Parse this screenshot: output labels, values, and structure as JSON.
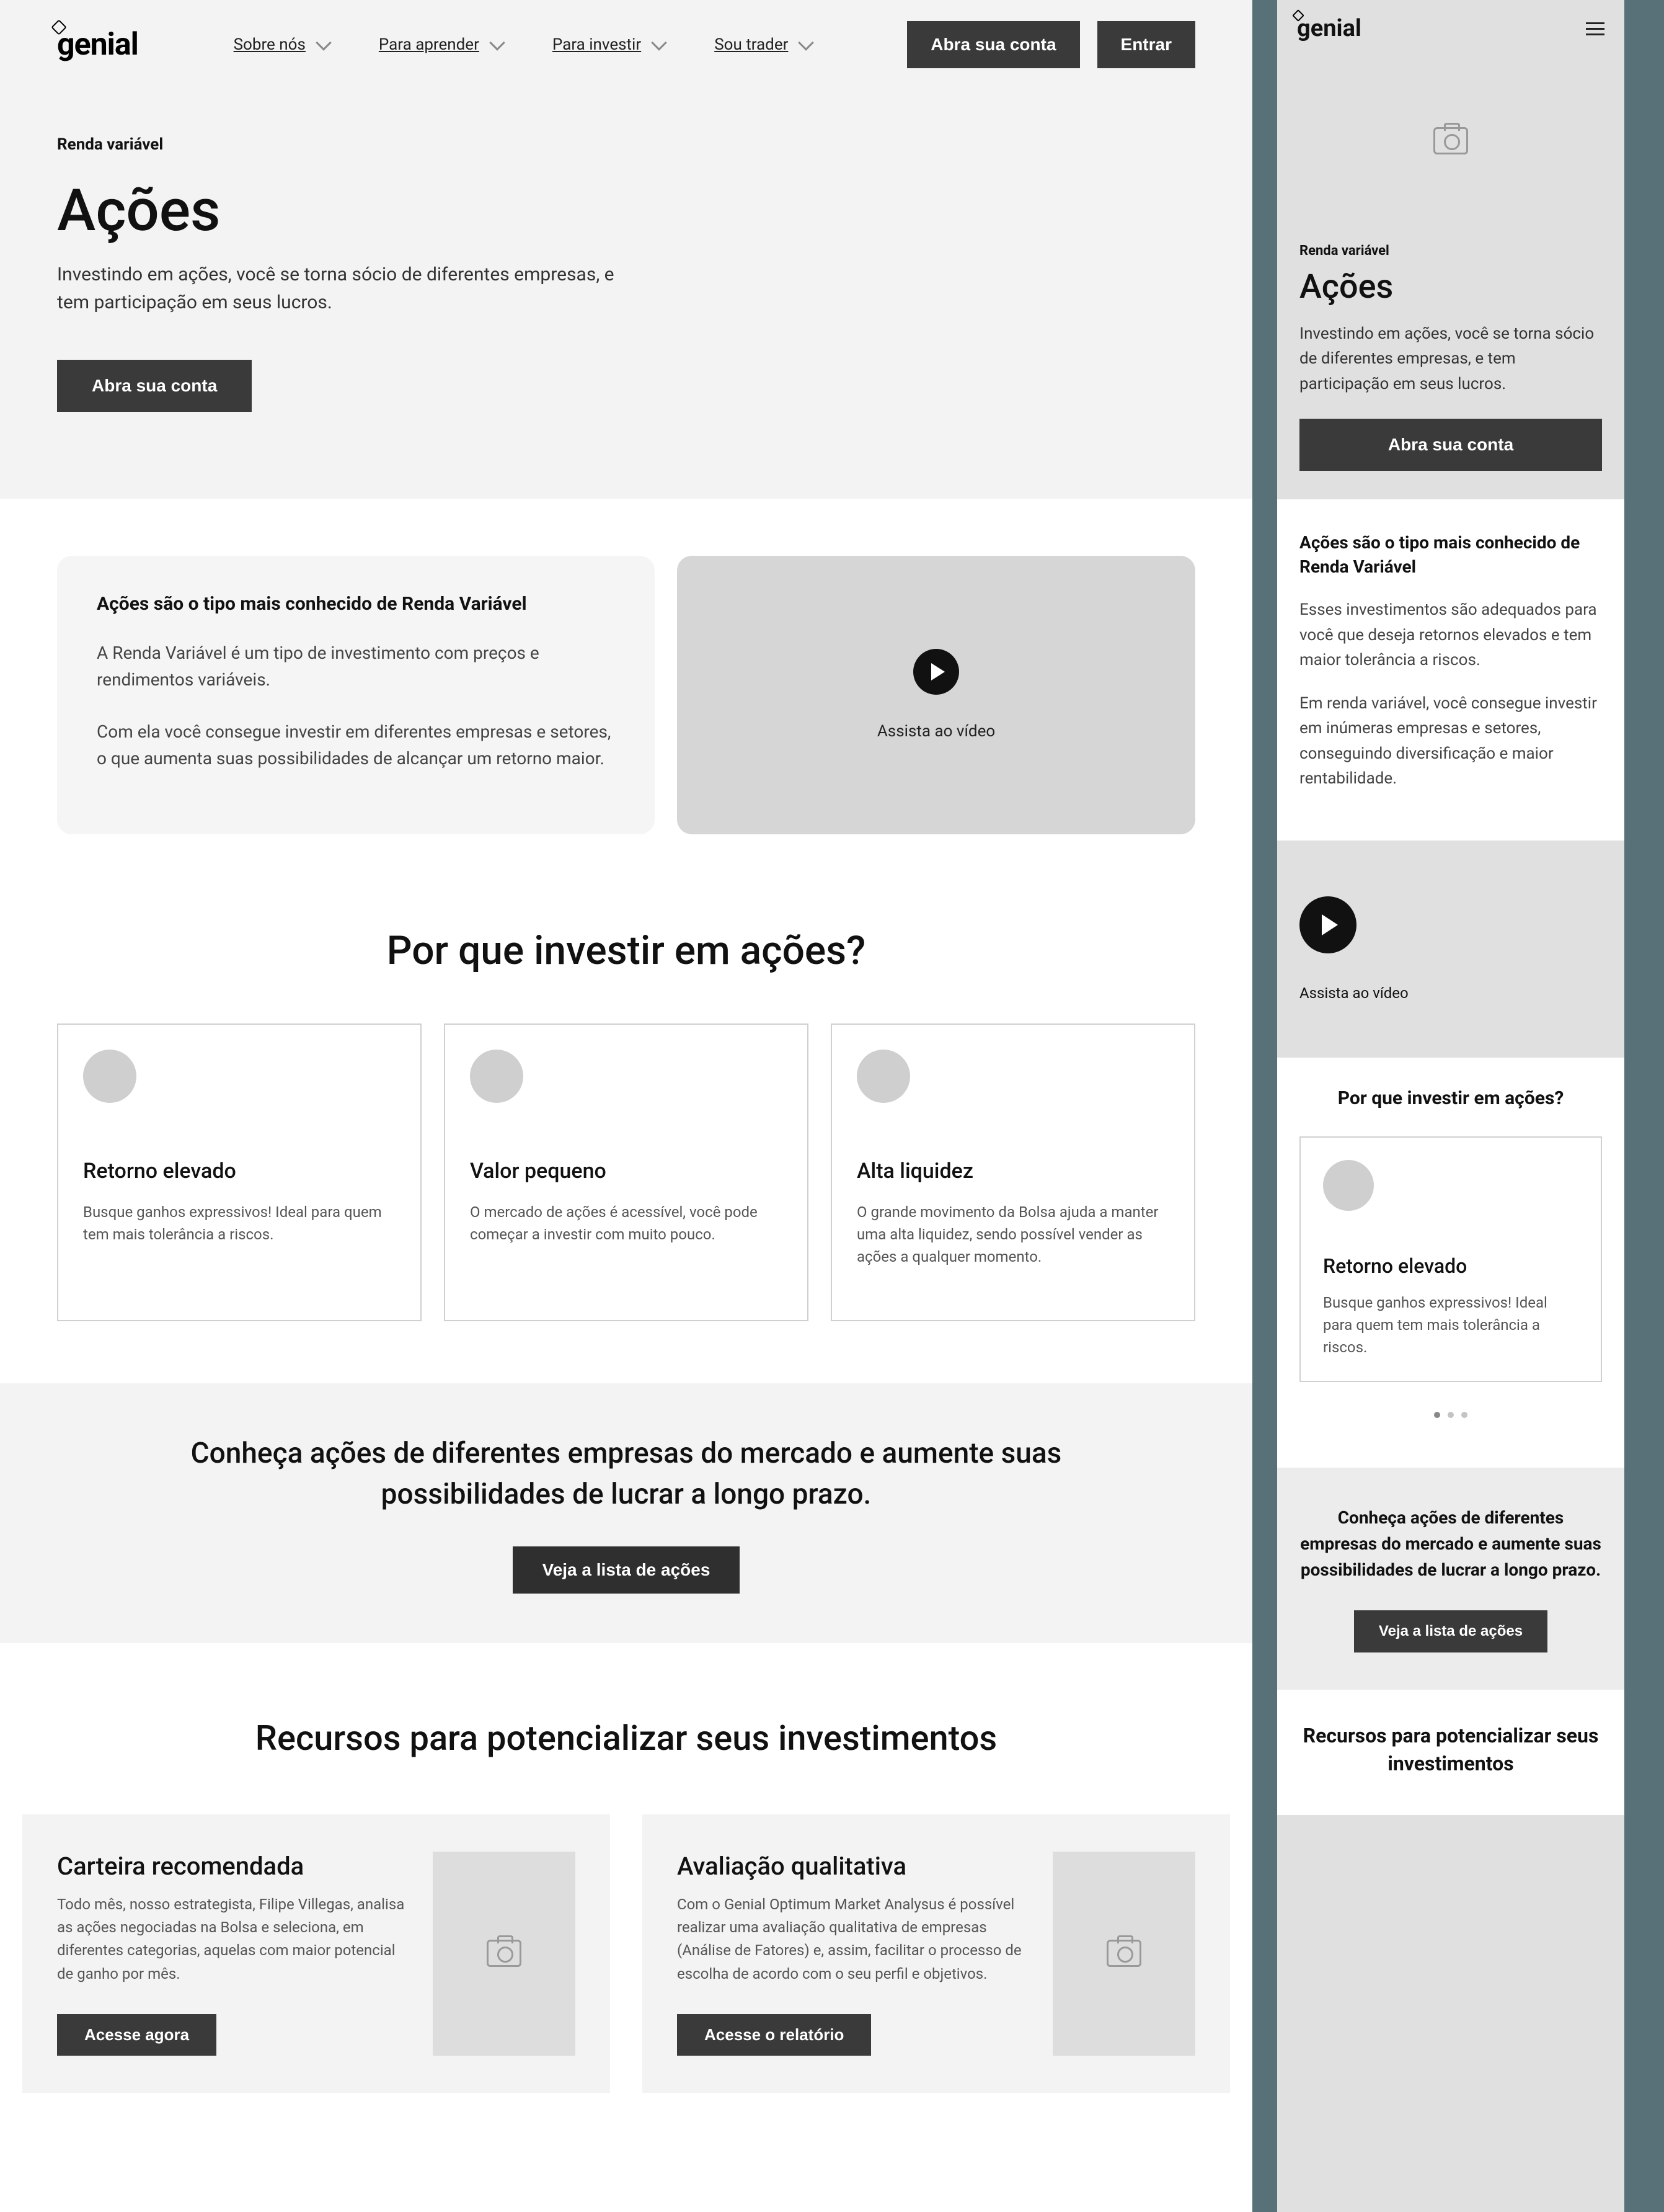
{
  "nav": {
    "logo": "genial",
    "items": [
      "Sobre nós",
      "Para aprender",
      "Para investir",
      "Sou trader"
    ],
    "cta_primary": "Abra sua conta",
    "cta_secondary": "Entrar"
  },
  "hero": {
    "eyebrow": "Renda variável",
    "title": "Ações",
    "subtitle": "Investindo em ações, você se torna sócio de diferentes empresas, e tem participação em seus lucros.",
    "cta": "Abra sua conta"
  },
  "info": {
    "heading": "Ações são o tipo mais conhecido de Renda Variável",
    "p1": "A Renda Variável é um tipo de investimento com preços e rendimentos variáveis.",
    "p2": "Com  ela você consegue investir em diferentes empresas e setores, o que aumenta suas possibilidades de alcançar um retorno maior.",
    "video_caption": "Assista ao vídeo"
  },
  "why": {
    "title": "Por que investir em ações?",
    "cards": [
      {
        "title": "Retorno elevado",
        "text": "Busque ganhos expressivos! Ideal para quem tem mais tolerância a riscos."
      },
      {
        "title": "Valor pequeno",
        "text": "O mercado de ações é acessível, você pode começar a investir com muito pouco."
      },
      {
        "title": "Alta liquidez",
        "text": "O grande movimento da Bolsa ajuda a manter uma alta liquidez, sendo possível vender as ações a qualquer momento."
      }
    ]
  },
  "band": {
    "heading": "Conheça ações de diferentes empresas do mercado e aumente suas possibilidades de lucrar a longo prazo.",
    "cta": "Veja a lista de ações"
  },
  "resources": {
    "title": "Recursos para potencializar seus investimentos",
    "cards": [
      {
        "title": "Carteira recomendada",
        "text": "Todo mês, nosso estrategista, Filipe Villegas, analisa as ações negociadas na Bolsa e seleciona, em diferentes categorias, aquelas com maior potencial de ganho por mês.",
        "cta": "Acesse agora"
      },
      {
        "title": "Avaliação qualitativa",
        "text": "Com o Genial Optimum Market Analysus é possível realizar uma avaliação qualitativa de empresas (Análise de Fatores) e, assim, facilitar o processo de escolha de acordo com o seu perfil e objetivos.",
        "cta": "Acesse o relatório"
      }
    ]
  },
  "mobile_info": {
    "heading": "Ações são o tipo mais conhecido de Renda Variável",
    "p1": "Esses investimentos são adequados para você que deseja retornos elevados e tem maior tolerância a riscos.",
    "p2": "Em renda variável, você consegue investir em inúmeras empresas e setores, conseguindo diversificação e maior rentabilidade."
  }
}
